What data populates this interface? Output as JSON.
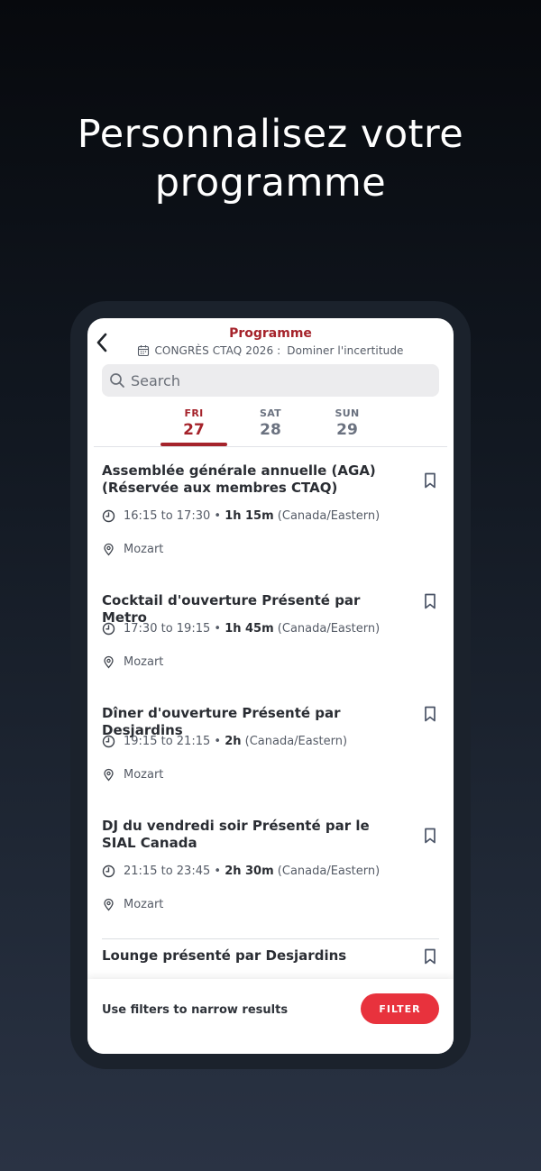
{
  "promo": {
    "headline_line1": "Personnalisez votre",
    "headline_line2": "programme"
  },
  "header": {
    "title": "Programme",
    "event_name": "CONGRÈS CTAQ 2026 :",
    "event_theme": "Dominer l'incertitude"
  },
  "search": {
    "placeholder": "Search"
  },
  "days": [
    {
      "name": "FRI",
      "date": "27",
      "active": true
    },
    {
      "name": "SAT",
      "date": "28",
      "active": false
    },
    {
      "name": "SUN",
      "date": "29",
      "active": false
    }
  ],
  "sessions": [
    {
      "title": "Assemblée générale annuelle (AGA) (Réservée aux membres CTAQ)",
      "time": "16:15 to 17:30",
      "duration": "1h 15m",
      "timezone": "(Canada/Eastern)",
      "location": "Mozart"
    },
    {
      "title": "Cocktail d'ouverture Présenté par Metro",
      "time": "17:30 to 19:15",
      "duration": "1h 45m",
      "timezone": "(Canada/Eastern)",
      "location": "Mozart"
    },
    {
      "title": "Dîner d'ouverture Présenté par Desjardins",
      "time": "19:15 to 21:15",
      "duration": "2h",
      "timezone": "(Canada/Eastern)",
      "location": "Mozart"
    },
    {
      "title": "DJ du vendredi soir Présenté par le SIAL Canada",
      "time": "21:15 to 23:45",
      "duration": "2h 30m",
      "timezone": "(Canada/Eastern)",
      "location": "Mozart"
    },
    {
      "title": "Lounge présenté par Desjardins"
    }
  ],
  "footer": {
    "hint": "Use filters to narrow results",
    "filter_label": "FILTER"
  },
  "colors": {
    "accent": "#a5232b",
    "filter_button": "#e8323d",
    "background_top": "#07090d",
    "background_bottom": "#2a3344"
  },
  "icons": [
    "back-arrow-icon",
    "calendar-icon",
    "search-icon",
    "bookmark-icon",
    "clock-icon",
    "location-pin-icon"
  ]
}
